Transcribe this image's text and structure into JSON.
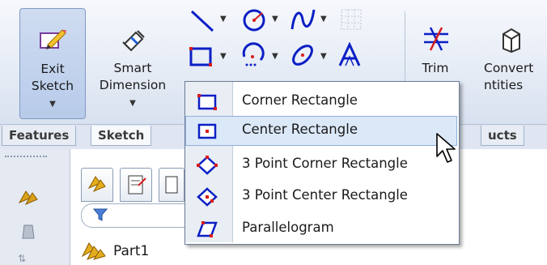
{
  "toolbar": {
    "exit_sketch": {
      "line1": "Exit",
      "line2": "Sketch"
    },
    "smart_dimension": {
      "line1": "Smart",
      "line2": "Dimension"
    },
    "trim": {
      "label": "Trim"
    },
    "convert_entities": {
      "line1": "Convert",
      "line2": "ntities"
    }
  },
  "tabs": [
    {
      "label": "Features"
    },
    {
      "label": "Sketch"
    },
    {
      "label": "ucts"
    }
  ],
  "menu": {
    "items": [
      {
        "label": "Corner Rectangle",
        "icon": "corner-rectangle-icon"
      },
      {
        "label": "Center Rectangle",
        "icon": "center-rectangle-icon",
        "highlighted": true
      },
      {
        "label": "3 Point Corner Rectangle",
        "icon": "3-point-corner-rectangle-icon"
      },
      {
        "label": "3 Point Center Rectangle",
        "icon": "3-point-center-rectangle-icon"
      },
      {
        "label": "Parallelogram",
        "icon": "parallelogram-icon"
      }
    ]
  },
  "feature_tree": {
    "root_label": "Part1"
  },
  "colors": {
    "accent_blue": "#0b1fc4",
    "highlight": "#dbe8f8",
    "icon_red": "#d81b1b"
  }
}
